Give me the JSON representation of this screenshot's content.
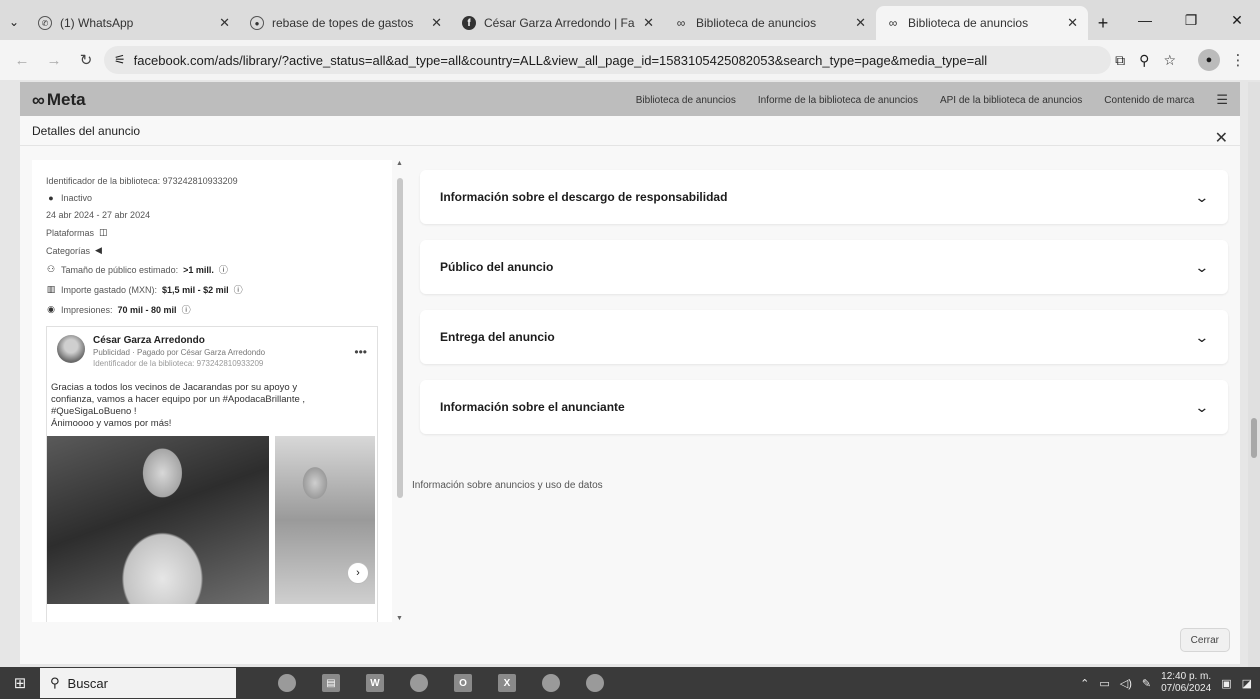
{
  "browser": {
    "tabs": [
      {
        "title": "(1) WhatsApp",
        "icon": "whatsapp-icon",
        "active": false
      },
      {
        "title": "rebase de topes de gastos",
        "icon": "chrome-icon",
        "active": false
      },
      {
        "title": "César Garza Arredondo | Fa",
        "icon": "facebook-icon",
        "active": false
      },
      {
        "title": "Biblioteca de anuncios",
        "icon": "meta-icon",
        "active": false
      },
      {
        "title": "Biblioteca de anuncios",
        "icon": "meta-icon",
        "active": true
      }
    ],
    "url": "facebook.com/ads/library/?active_status=all&ad_type=all&country=ALL&view_all_page_id=1583105425082053&search_type=page&media_type=all"
  },
  "meta": {
    "logo": "Meta",
    "nav": [
      "Biblioteca de anuncios",
      "Informe de la biblioteca de anuncios",
      "API de la biblioteca de anuncios",
      "Contenido de marca"
    ]
  },
  "modal": {
    "title": "Detalles del anuncio",
    "close_label": "Cerrar",
    "details": {
      "library_id": "Identificador de la biblioteca: 973242810933209",
      "status": "Inactivo",
      "dates": "24 abr 2024 - 27 abr 2024",
      "platforms": "Plataformas",
      "categories": "Categorías",
      "audience_label": "Tamaño de público estimado:",
      "audience_value": ">1 mill.",
      "spend_label": "Importe gastado (MXN):",
      "spend_value": "$1,5 mil - $2 mil",
      "impressions_label": "Impresiones:",
      "impressions_value": "70 mil - 80 mil"
    },
    "post": {
      "author": "César Garza Arredondo",
      "subtitle": "Publicidad · Pagado por César Garza Arredondo",
      "library_id": "Identificador de la biblioteca: 973242810933209",
      "text": "Gracias a todos los vecinos de Jacarandas por su apoyo y\nconfianza, vamos a hacer equipo por un #ApodacaBrillante ,\n#QueSigaLoBueno !\nÁnimoooo y vamos por más!"
    },
    "sections": [
      "Información sobre el descargo de responsabilidad",
      "Público del anuncio",
      "Entrega del anuncio",
      "Información sobre el anunciante"
    ],
    "footer_link": "Información sobre anuncios y uso de datos"
  },
  "taskbar": {
    "search_placeholder": "Buscar",
    "time": "12:40 p. m.",
    "date": "07/06/2024"
  }
}
